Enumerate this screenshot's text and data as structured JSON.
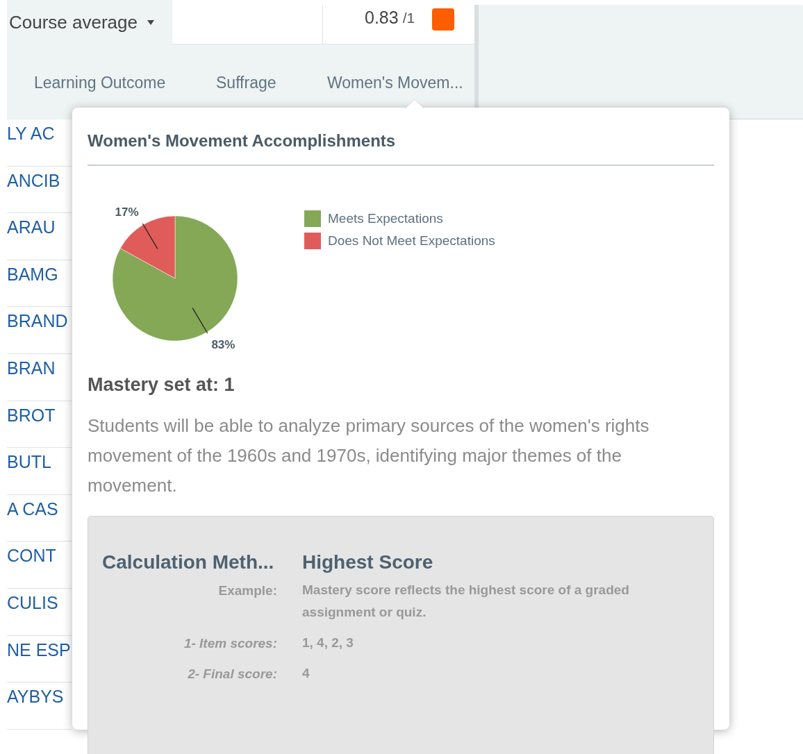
{
  "header": {
    "average_label": "Course average",
    "score": "0.83",
    "score_total": "/1"
  },
  "tabs": [
    {
      "label": "Learning Outcome"
    },
    {
      "label": "Suffrage"
    },
    {
      "label": "Women's Movem..."
    }
  ],
  "students": [
    "LY AC",
    "ANCIB",
    "ARAU",
    "BAMG",
    "BRAND",
    "BRAN",
    "BROT",
    "BUTL",
    "A CAS",
    "CONT",
    "CULIS",
    "NE ESP",
    "AYBYS"
  ],
  "popover": {
    "title": "Women's Movement Accomplishments",
    "chart_data": {
      "type": "pie",
      "categories": [
        "Meets Expectations",
        "Does Not Meet Expectations"
      ],
      "values": [
        83,
        17
      ],
      "colors": [
        "#84a856",
        "#e05c5a"
      ],
      "value_labels": [
        "83%",
        "17%"
      ]
    },
    "mastery": "Mastery set at: 1",
    "description": "Students will be able to analyze primary sources of the women's rights movement of the 1960s and 1970s, identifying major themes of the movement.",
    "calculation": {
      "label": "Calculation Meth...",
      "method": "Highest Score",
      "rows": [
        {
          "label": "Example:",
          "value": "Mastery score reflects the highest score of a graded assignment or quiz.",
          "kind": "plain"
        },
        {
          "label": "1- Item scores:",
          "value": "1, 4, 2, 3",
          "kind": "step"
        },
        {
          "label": "2- Final score:",
          "value": "4",
          "kind": "step"
        }
      ]
    }
  }
}
